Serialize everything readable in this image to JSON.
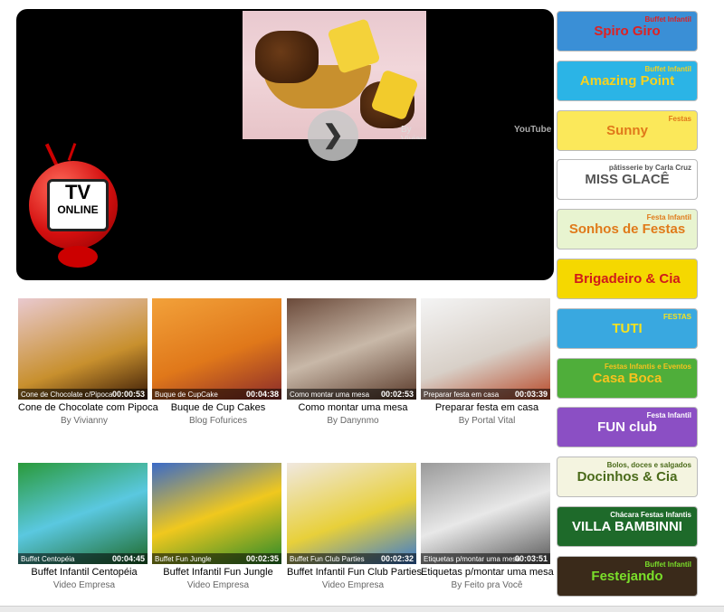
{
  "player": {
    "byline": "By Vivianny",
    "youtube": "YouTube",
    "tv_line1": "TV",
    "tv_line2": "ONLINE"
  },
  "videos": [
    {
      "caption": "Cone de Chocolate c/Pipoca",
      "duration": "00:00:53",
      "title": "Cone de Chocolate com Pipoca",
      "by": "By Vivianny"
    },
    {
      "caption": "Buque de CupCake",
      "duration": "00:04:38",
      "title": "Buque de Cup Cakes",
      "by": "Blog Fofurices"
    },
    {
      "caption": "Como montar uma mesa",
      "duration": "00:02:53",
      "title": "Como montar uma mesa",
      "by": "By Danynmo"
    },
    {
      "caption": "Preparar festa em casa",
      "duration": "00:03:39",
      "title": "Preparar festa em casa",
      "by": "By Portal Vital"
    },
    {
      "caption": "Buffet Centopéia",
      "duration": "00:04:45",
      "title": "Buffet Infantil Centopéia",
      "by": "Video Empresa"
    },
    {
      "caption": "Buffet Fun Jungle",
      "duration": "00:02:35",
      "title": "Buffet Infantil Fun Jungle",
      "by": "Video Empresa"
    },
    {
      "caption": "Buffet Fun Club Parties",
      "duration": "00:02:32",
      "title": "Buffet Infantil Fun Club Parties",
      "by": "Video Empresa"
    },
    {
      "caption": "Etiquetas p/montar uma mesa",
      "duration": "00:03:51",
      "title": "Etiquetas p/montar uma mesa",
      "by": "By Feito pra Você"
    }
  ],
  "ads": [
    {
      "name": "Spiro Giro",
      "sub": "Buffet Infantil",
      "bg": "#3a8fd6",
      "fg": "#e02020"
    },
    {
      "name": "Amazing Point",
      "sub": "Buffet Infantil",
      "bg": "#2bb4e6",
      "fg": "#f7d21e"
    },
    {
      "name": "Sunny",
      "sub": "Festas",
      "bg": "#fbe85a",
      "fg": "#e0781a"
    },
    {
      "name": "MISS GLACÊ",
      "sub": "pâtisserie by Carla Cruz",
      "bg": "#ffffff",
      "fg": "#555555"
    },
    {
      "name": "Sonhos de Festas",
      "sub": "Festa Infantil",
      "bg": "#e8f4d0",
      "fg": "#e07a1a"
    },
    {
      "name": "Brigadeiro & Cia",
      "sub": "",
      "bg": "#f5d800",
      "fg": "#d01a1a"
    },
    {
      "name": "TUTI",
      "sub": "FESTAS",
      "bg": "#39a8e0",
      "fg": "#f7e21e"
    },
    {
      "name": "Casa Boca",
      "sub": "Festas Infantis e Eventos",
      "bg": "#4fae3a",
      "fg": "#f7c21e"
    },
    {
      "name": "FUN club",
      "sub": "Festa Infantil",
      "bg": "#8b4fc4",
      "fg": "#ffffff"
    },
    {
      "name": "Docinhos & Cia",
      "sub": "Bolos, doces e salgados",
      "bg": "#f4f4e0",
      "fg": "#4a6a1a"
    },
    {
      "name": "VILLA BAMBINNI",
      "sub": "Chácara Festas Infantis",
      "bg": "#1e6a2a",
      "fg": "#ffffff"
    },
    {
      "name": "Festejando",
      "sub": "Buffet Infantil",
      "bg": "#3a2a1a",
      "fg": "#7adf2a"
    }
  ]
}
